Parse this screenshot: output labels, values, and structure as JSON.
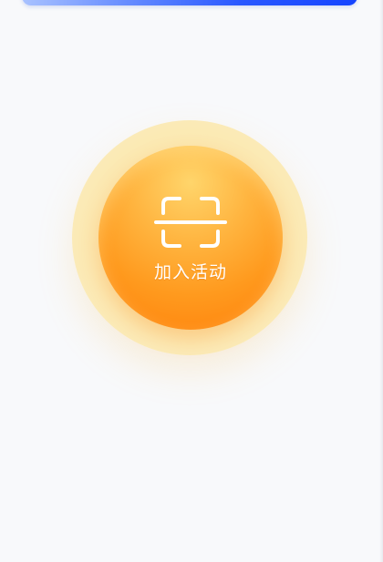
{
  "top_banner": {
    "colors": [
      "#a9c2ff",
      "#2a58ff",
      "#1544ff"
    ]
  },
  "join_button": {
    "label": "加入活动",
    "icon": "scan-icon",
    "colors": {
      "inner_top": "#ffd56b",
      "inner_bottom": "#ff7f0a",
      "halo": "#fde7a6",
      "text": "#ffffff"
    }
  },
  "background_color": "#f8f9fb"
}
